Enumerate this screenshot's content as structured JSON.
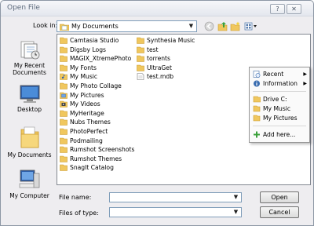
{
  "window": {
    "title": "Open File",
    "help_label": "?",
    "close_label": "✕"
  },
  "lookin": {
    "label": "Look in:",
    "value": "My Documents",
    "arrow": "▼"
  },
  "places": [
    {
      "label": "My Recent Documents",
      "icon": "recent-documents-icon"
    },
    {
      "label": "Desktop",
      "icon": "desktop-icon"
    },
    {
      "label": "My Documents",
      "icon": "my-documents-icon"
    },
    {
      "label": "My Computer",
      "icon": "my-computer-icon"
    }
  ],
  "files_col1": [
    {
      "name": "Camtasia Studio",
      "icon": "folder-icon"
    },
    {
      "name": "Digsby Logs",
      "icon": "folder-icon"
    },
    {
      "name": "MAGIX_XtremePhoto",
      "icon": "folder-icon"
    },
    {
      "name": "My Fonts",
      "icon": "folder-icon"
    },
    {
      "name": "My Music",
      "icon": "music-folder-icon"
    },
    {
      "name": "My Photo Collage",
      "icon": "folder-icon"
    },
    {
      "name": "My Pictures",
      "icon": "pictures-folder-icon"
    },
    {
      "name": "My Videos",
      "icon": "videos-folder-icon"
    },
    {
      "name": "MyHeritage",
      "icon": "folder-icon"
    },
    {
      "name": "Nubs Themes",
      "icon": "folder-icon"
    },
    {
      "name": "PhotoPerfect",
      "icon": "folder-icon"
    },
    {
      "name": "Podmailing",
      "icon": "folder-icon"
    },
    {
      "name": "Rumshot Screenshots",
      "icon": "folder-icon"
    },
    {
      "name": "Rumshot Themes",
      "icon": "folder-icon"
    },
    {
      "name": "SnagIt Catalog",
      "icon": "folder-icon"
    }
  ],
  "files_col2": [
    {
      "name": "Synthesia Music",
      "icon": "folder-icon"
    },
    {
      "name": "test",
      "icon": "folder-icon"
    },
    {
      "name": "torrents",
      "icon": "folder-icon"
    },
    {
      "name": "UltraGet",
      "icon": "folder-icon"
    },
    {
      "name": "test.mdb",
      "icon": "file-icon"
    }
  ],
  "context_menu": {
    "items": [
      {
        "label": "Recent",
        "icon": "recent-icon",
        "submenu": "▶"
      },
      {
        "label": "Information",
        "icon": "info-icon",
        "submenu": "▶"
      },
      {
        "label": "Drive C:",
        "icon": "drive-icon"
      },
      {
        "label": "My Music",
        "icon": "folder-icon"
      },
      {
        "label": "My Pictures",
        "icon": "folder-icon"
      },
      {
        "label": "Add here...",
        "icon": "add-icon"
      }
    ]
  },
  "form": {
    "filename_label": "File name:",
    "filename_value": "",
    "filetype_label": "Files of type:",
    "filetype_value": "",
    "arrow": "▼",
    "open_label": "Open",
    "cancel_label": "Cancel"
  },
  "colors": {
    "folder": "#f0c75e",
    "folder_dark": "#d9a93a",
    "border_blue": "#7f9db9"
  }
}
